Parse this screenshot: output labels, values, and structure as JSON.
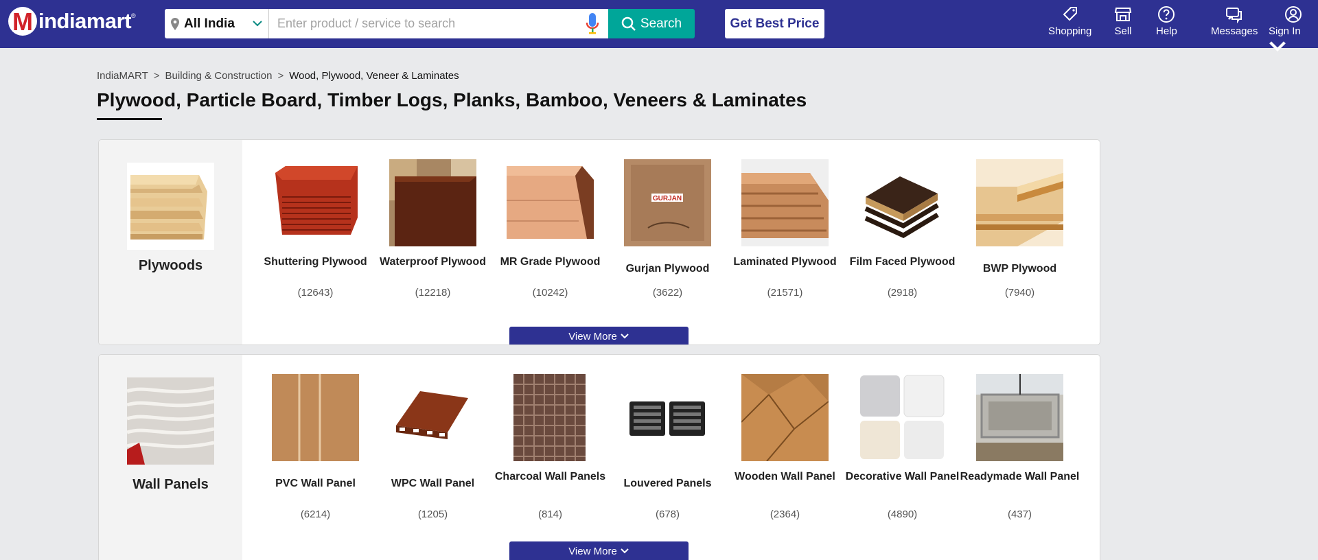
{
  "header": {
    "logo_text": "indiamart",
    "location": "All India",
    "search_placeholder": "Enter product / service to search",
    "search_label": "Search",
    "best_price_label": "Get Best Price",
    "nav": [
      {
        "label": "Shopping",
        "icon": "tag-icon"
      },
      {
        "label": "Sell",
        "icon": "store-icon"
      },
      {
        "label": "Help",
        "icon": "help-icon"
      },
      {
        "label": "Messages",
        "icon": "messages-icon"
      },
      {
        "label": "Sign In",
        "icon": "user-icon"
      }
    ]
  },
  "breadcrumb": [
    "IndiaMART",
    "Building & Construction",
    "Wood, Plywood, Veneer & Laminates"
  ],
  "breadcrumb_sep": ">",
  "page_title": "Plywood, Particle Board, Timber Logs, Planks, Bamboo, Veneers & Laminates",
  "colors": {
    "header_bg": "#2e3192",
    "search_btn": "#00a699",
    "view_more_bg": "#2e3192",
    "logo_red": "#d1232a"
  },
  "categories": [
    {
      "name": "Plywoods",
      "view_more": "View More",
      "items": [
        {
          "name": "Shuttering Plywood",
          "count": "(12643)"
        },
        {
          "name": "Waterproof Plywood",
          "count": "(12218)"
        },
        {
          "name": "MR Grade Plywood",
          "count": "(10242)"
        },
        {
          "name": "Gurjan Plywood",
          "count": "(3622)"
        },
        {
          "name": "Laminated Plywood",
          "count": "(21571)"
        },
        {
          "name": "Film Faced Plywood",
          "count": "(2918)"
        },
        {
          "name": "BWP Plywood",
          "count": "(7940)"
        }
      ]
    },
    {
      "name": "Wall Panels",
      "view_more": "View More",
      "items": [
        {
          "name": "PVC Wall Panel",
          "count": "(6214)"
        },
        {
          "name": "WPC Wall Panel",
          "count": "(1205)"
        },
        {
          "name": "Charcoal Wall Panels",
          "count": "(814)"
        },
        {
          "name": "Louvered Panels",
          "count": "(678)"
        },
        {
          "name": "Wooden Wall Panel",
          "count": "(2364)"
        },
        {
          "name": "Decorative Wall Panel",
          "count": "(4890)"
        },
        {
          "name": "Readymade Wall Panel",
          "count": "(437)"
        }
      ]
    }
  ]
}
